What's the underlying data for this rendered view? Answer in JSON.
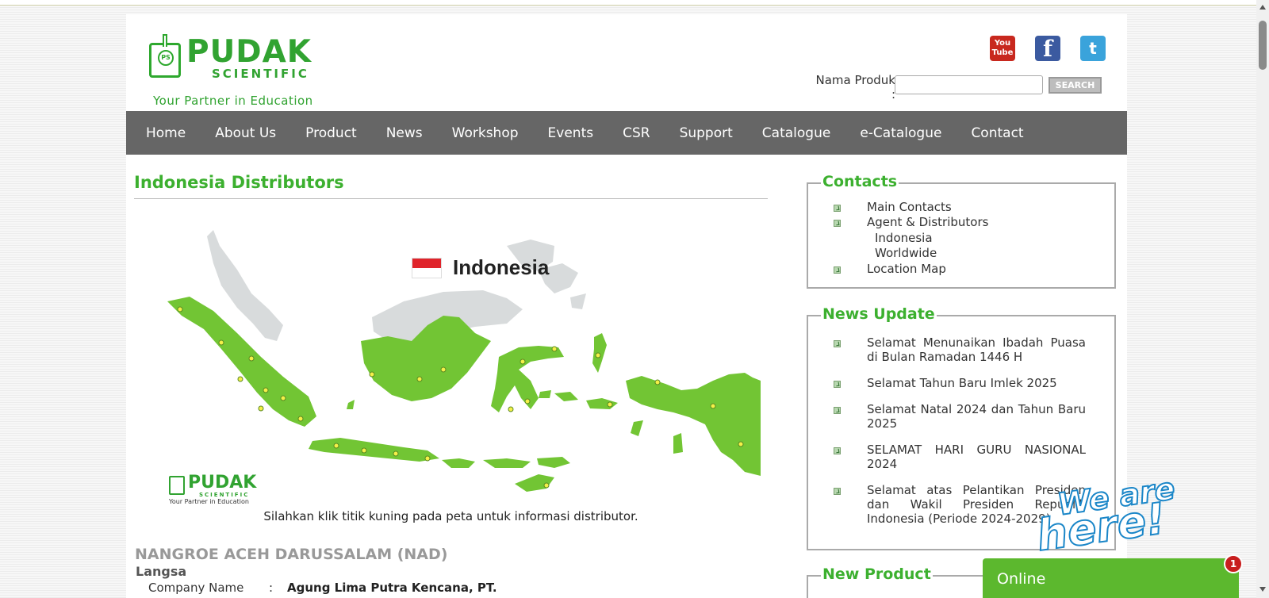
{
  "brand": {
    "logo_text": "PUDAK",
    "logo_sub": "SCIENTIFIC",
    "tagline": "Your Partner in Education",
    "logo_mark": "PS",
    "color_primary": "#3cb02f"
  },
  "header": {
    "social": [
      {
        "name": "youtube-icon",
        "label": "You Tube"
      },
      {
        "name": "facebook-icon",
        "label": "f"
      },
      {
        "name": "twitter-icon",
        "label": "t"
      }
    ],
    "search": {
      "label": "Nama Produk :",
      "value": "",
      "button_label": "SEARCH"
    }
  },
  "nav": {
    "items": [
      "Home",
      "About Us",
      "Product",
      "News",
      "Workshop",
      "Events",
      "CSR",
      "Support",
      "Catalogue",
      "e-Catalogue",
      "Contact"
    ],
    "background": "#666666"
  },
  "main": {
    "title": "Indonesia Distributors",
    "map": {
      "title": "Indonesia",
      "logo_text": "PUDAK",
      "logo_sub": "SCIENTIFIC",
      "logo_tag": "Your Partner in Education",
      "land_color": "#72c534",
      "neighbor_color": "#d8dbdc",
      "marker_color": "#f5f049"
    },
    "caption": "Silahkan klik titik kuning pada peta untuk informasi distributor.",
    "region": "NANGROE ACEH DARUSSALAM (NAD)",
    "city": "Langsa",
    "company": {
      "label": "Company Name",
      "colon": ":",
      "value": "Agung Lima Putra Kencana, PT."
    }
  },
  "sidebar": {
    "contacts": {
      "title": "Contacts",
      "items": [
        "Main Contacts",
        "Agent & Distributors",
        "Location Map"
      ],
      "sub_items": [
        "Indonesia",
        "Worldwide"
      ]
    },
    "news": {
      "title": "News Update",
      "items": [
        "Selamat Menunaikan Ibadah Puasa di Bulan Ramadan 1446 H",
        "Selamat Tahun Baru Imlek 2025",
        "Selamat Natal 2024 dan Tahun Baru 2025",
        "SELAMAT HARI GURU NASIONAL 2024",
        "Selamat atas Pelantikan Presiden dan Wakil Presiden Republik Indonesia (Periode 2024-2029)"
      ]
    },
    "new_product": {
      "title": "New Product"
    }
  },
  "chat": {
    "banner_line1": "We are",
    "banner_line2": "here!",
    "status_label": "Online",
    "badge_count": "1",
    "color": "#5cb82e"
  }
}
